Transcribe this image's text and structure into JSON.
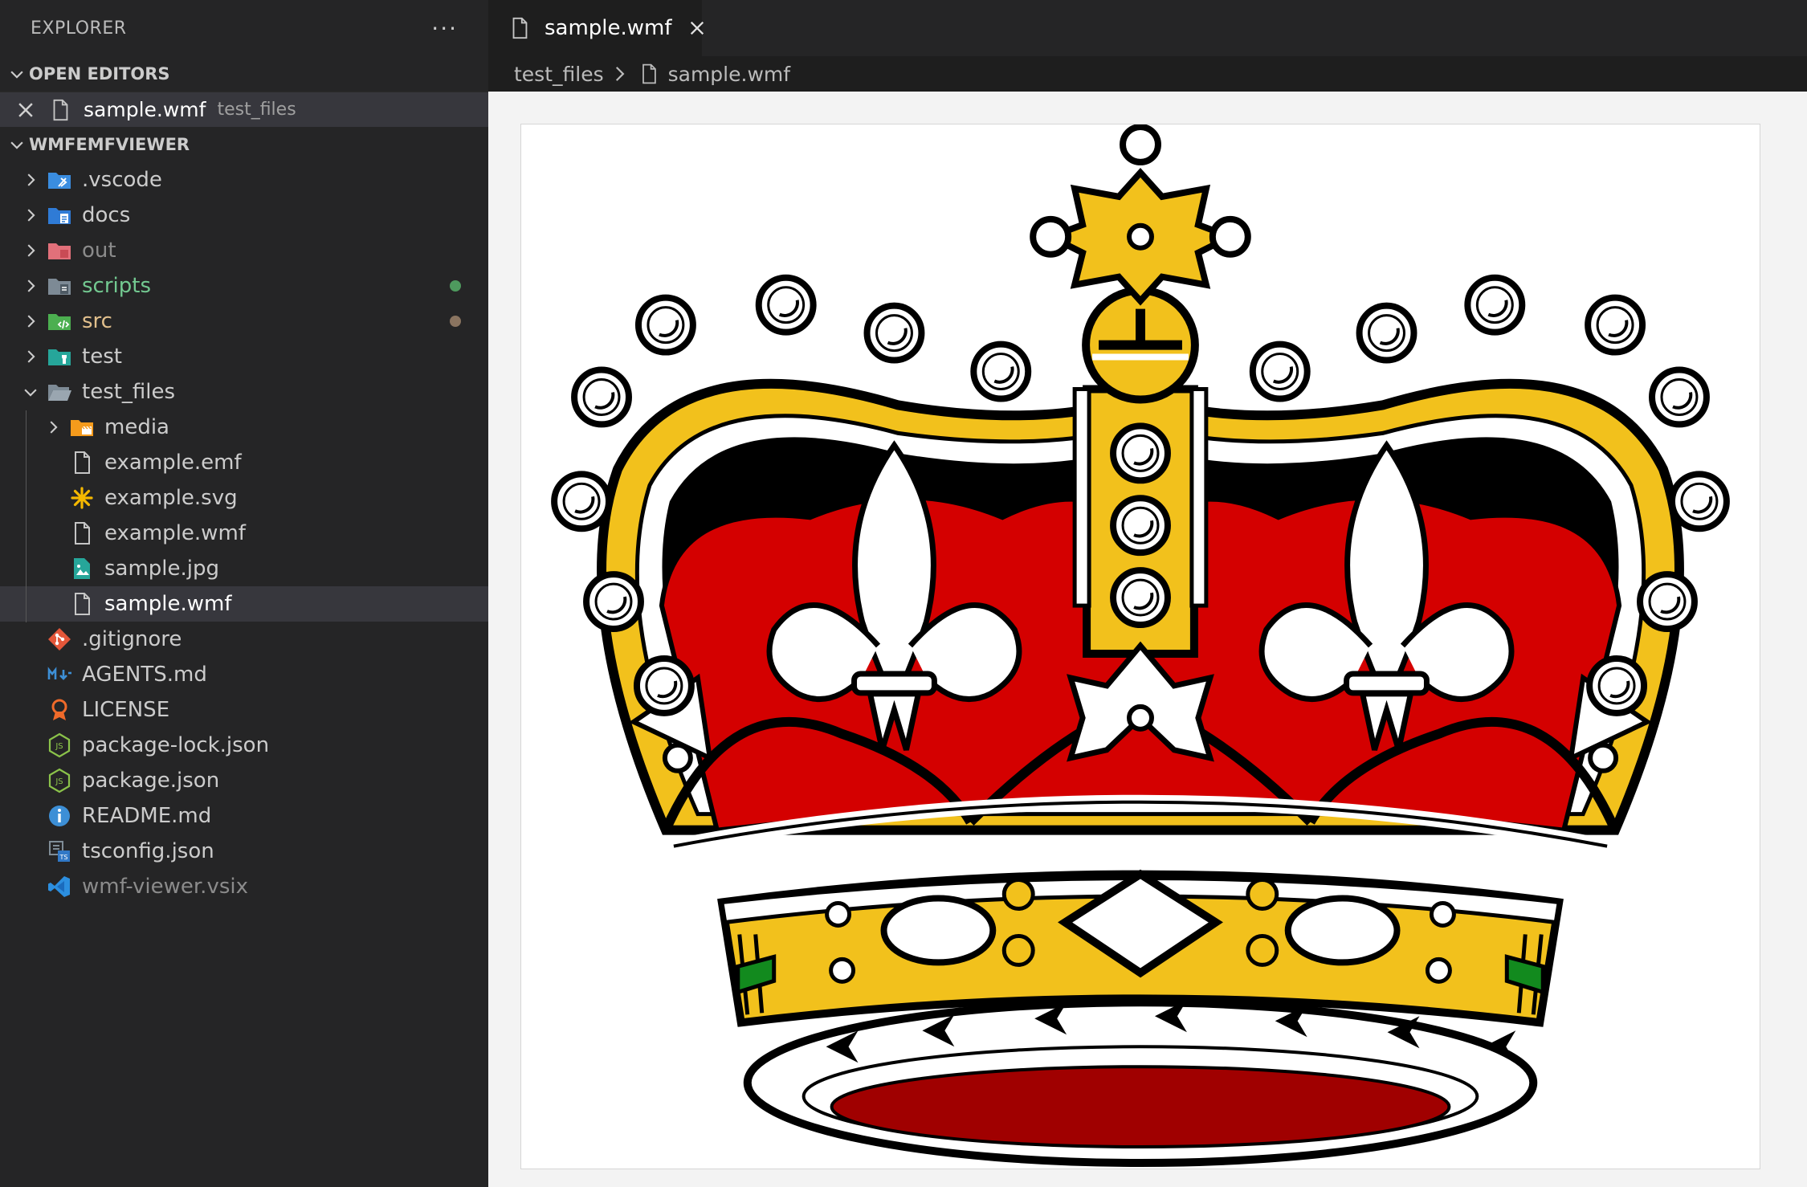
{
  "sidebar": {
    "title": "EXPLORER",
    "more": "···",
    "open_editors": {
      "header": "OPEN EDITORS",
      "items": [
        {
          "name": "sample.wmf",
          "description": "test_files"
        }
      ]
    },
    "workspace": {
      "header": "WMFEMFVIEWER",
      "items": [
        {
          "label": ".vscode",
          "kind": "folder",
          "icon": "vscode-folder-icon"
        },
        {
          "label": "docs",
          "kind": "folder",
          "icon": "docs-folder-icon"
        },
        {
          "label": "out",
          "kind": "folder",
          "icon": "out-folder-icon",
          "color": "#8b8b8b"
        },
        {
          "label": "scripts",
          "kind": "folder",
          "icon": "scripts-folder-icon",
          "color": "#73c991",
          "status_color": "#4e9a5e"
        },
        {
          "label": "src",
          "kind": "folder",
          "icon": "src-folder-icon",
          "color": "#e2c08d",
          "status_color": "#8a7460"
        },
        {
          "label": "test",
          "kind": "folder",
          "icon": "test-folder-icon"
        },
        {
          "label": "test_files",
          "kind": "folder-open",
          "icon": "open-folder-icon"
        },
        {
          "label": "media",
          "kind": "folder",
          "icon": "media-folder-icon",
          "nested": true
        },
        {
          "label": "example.emf",
          "kind": "file",
          "icon": "file-icon",
          "nested": true
        },
        {
          "label": "example.svg",
          "kind": "file",
          "icon": "svg-icon",
          "nested": true
        },
        {
          "label": "example.wmf",
          "kind": "file",
          "icon": "file-icon",
          "nested": true
        },
        {
          "label": "sample.jpg",
          "kind": "file",
          "icon": "image-icon",
          "nested": true
        },
        {
          "label": "sample.wmf",
          "kind": "file",
          "icon": "file-icon",
          "nested": true,
          "selected": true
        },
        {
          "label": ".gitignore",
          "kind": "file",
          "icon": "git-icon"
        },
        {
          "label": "AGENTS.md",
          "kind": "file",
          "icon": "markdown-icon"
        },
        {
          "label": "LICENSE",
          "kind": "file",
          "icon": "license-icon"
        },
        {
          "label": "package-lock.json",
          "kind": "file",
          "icon": "nodejs-icon"
        },
        {
          "label": "package.json",
          "kind": "file",
          "icon": "nodejs-icon"
        },
        {
          "label": "README.md",
          "kind": "file",
          "icon": "info-icon"
        },
        {
          "label": "tsconfig.json",
          "kind": "file",
          "icon": "tsconfig-icon"
        },
        {
          "label": "wmf-viewer.vsix",
          "kind": "file",
          "icon": "vscode-icon",
          "color": "#8b8b8b"
        }
      ]
    }
  },
  "editor": {
    "tab": {
      "label": "sample.wmf"
    },
    "breadcrumb": {
      "folder": "test_files",
      "file": "sample.wmf"
    },
    "image_subject": "crown-illustration"
  },
  "colors": {
    "sidebar_bg": "#252526",
    "editor_bg": "#1e1e1e",
    "selection_bg": "#37373d",
    "viewer_bg": "#f3f3f3",
    "crown_gold": "#f2c11c",
    "crown_red": "#d40000",
    "crown_dark_red": "#a00000",
    "crown_green": "#128a1e"
  }
}
